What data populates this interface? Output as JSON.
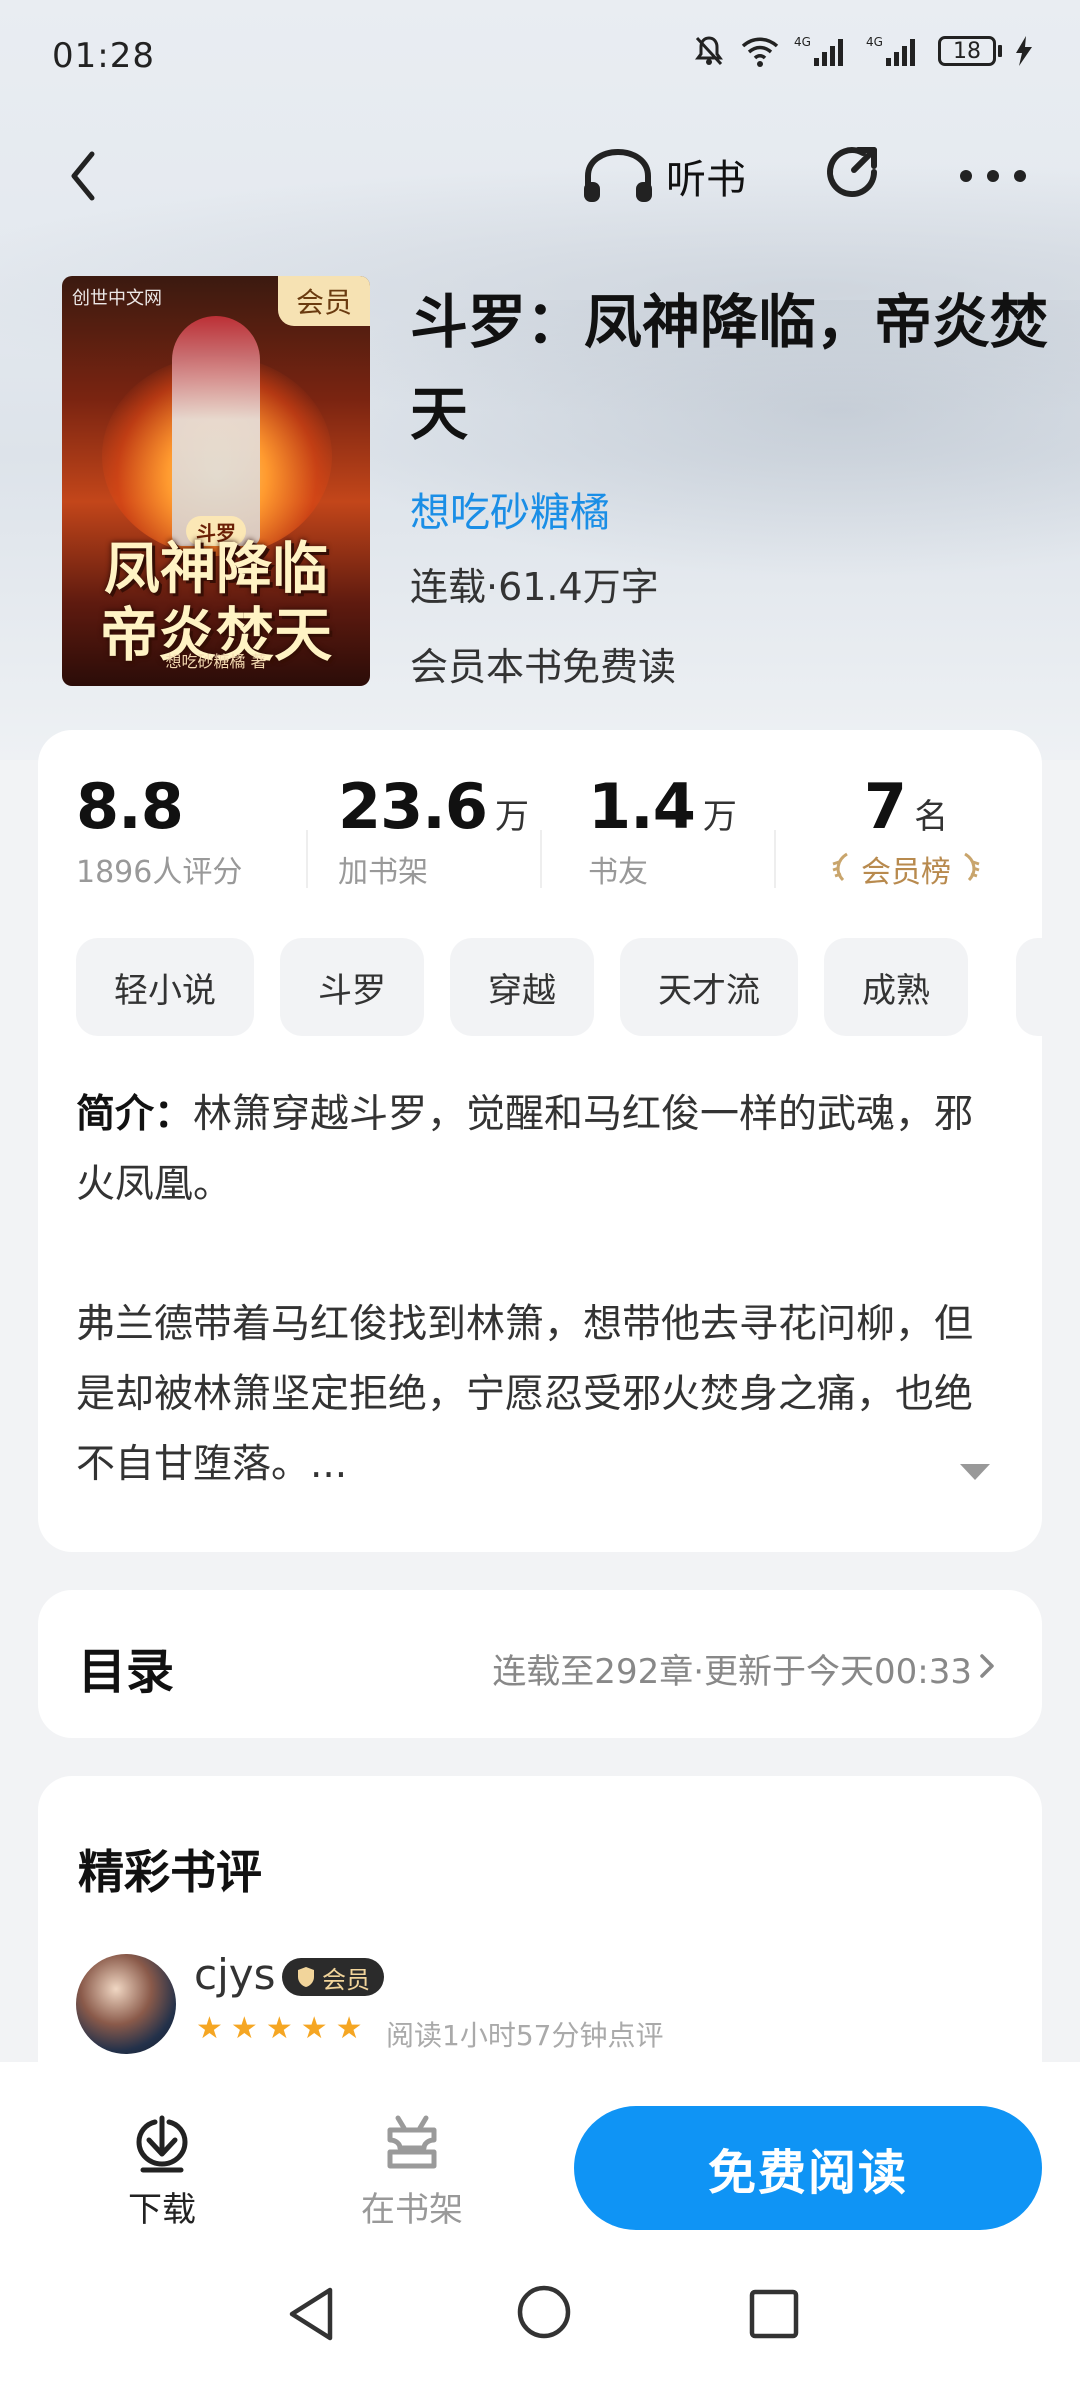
{
  "status_bar": {
    "time": "01:28",
    "battery": "18"
  },
  "top_nav": {
    "listen_label": "听书"
  },
  "book": {
    "cover": {
      "brand": "创世中文网",
      "vip_badge": "会员",
      "title_line1": "凤神降临",
      "title_line2": "帝炎焚天",
      "series_tag": "斗罗",
      "author_small": "想吃砂糖橘 著"
    },
    "title": "斗罗：凤神降临，帝炎焚天",
    "author": "想吃砂糖橘",
    "meta": "连载·61.4万字",
    "vip_read": "会员本书免费读"
  },
  "stats": [
    {
      "value": "8.8",
      "unit": "",
      "label": "1896人评分"
    },
    {
      "value": "23.6",
      "unit": "万",
      "label": "加书架"
    },
    {
      "value": "1.4",
      "unit": "万",
      "label": "书友"
    },
    {
      "value": "7",
      "unit": "名",
      "label": "会员榜"
    }
  ],
  "tags": [
    "轻小说",
    "斗罗",
    "穿越",
    "天才流",
    "成熟"
  ],
  "intro": {
    "prefix": "简介：",
    "p1": "林箫穿越斗罗，觉醒和马红俊一样的武魂，邪火凤凰。",
    "p2": "弗兰德带着马红俊找到林箫，想带他去寻花问柳，但是却被林箫坚定拒绝，宁愿忍受邪火焚身之痛，也绝不自甘堕落。..."
  },
  "toc": {
    "title": "目录",
    "info": "连载至292章·更新于今天00:33"
  },
  "reviews": {
    "title": "精彩书评",
    "items": [
      {
        "user": "cjys",
        "badge": "会员",
        "stars": 5,
        "meta": "阅读1小时57分钟点评"
      }
    ]
  },
  "bottom_bar": {
    "download_label": "下载",
    "shelf_label": "在书架",
    "read_label": "免费阅读"
  },
  "colors": {
    "accent_blue": "#0f94f5",
    "author_blue": "#1a8ee6",
    "rank_gold": "#b88a4e"
  }
}
